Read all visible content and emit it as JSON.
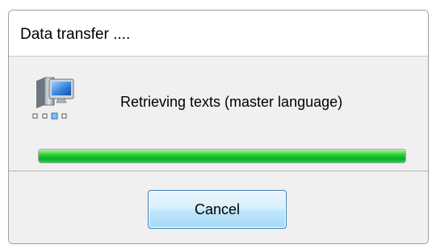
{
  "dialog": {
    "title": "Data transfer ....",
    "status_text": "Retrieving texts (master language)",
    "icon": "network-computer-icon",
    "progress": {
      "percent": 100,
      "color": "#06b025"
    },
    "cancel_label": "Cancel"
  }
}
